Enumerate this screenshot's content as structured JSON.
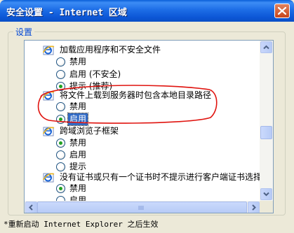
{
  "window": {
    "title": "安全设置 - Internet 区域",
    "close_icon": "close-icon"
  },
  "group": {
    "label": "设置"
  },
  "settings": [
    {
      "label": "加载应用程序和不安全文件",
      "options": [
        {
          "label": "禁用",
          "checked": false
        },
        {
          "label": "启用 (不安全)",
          "checked": false
        },
        {
          "label": "提示 (推荐)",
          "checked": true
        }
      ]
    },
    {
      "label": "将文件上载到服务器时包含本地目录路径",
      "options": [
        {
          "label": "禁用",
          "checked": false
        },
        {
          "label": "启用",
          "checked": true
        }
      ]
    },
    {
      "label": "跨域浏览子框架",
      "options": [
        {
          "label": "禁用",
          "checked": true
        },
        {
          "label": "启用",
          "checked": false
        },
        {
          "label": "提示",
          "checked": false
        }
      ]
    },
    {
      "label": "没有证书或只有一个证书时不提示进行客户端证书选择",
      "options": [
        {
          "label": "禁用",
          "checked": true
        },
        {
          "label": "启用",
          "checked": false
        }
      ]
    }
  ],
  "footnote": "*重新启动 Internet Explorer 之后生效",
  "annotation": {
    "color": "#e0140f"
  }
}
